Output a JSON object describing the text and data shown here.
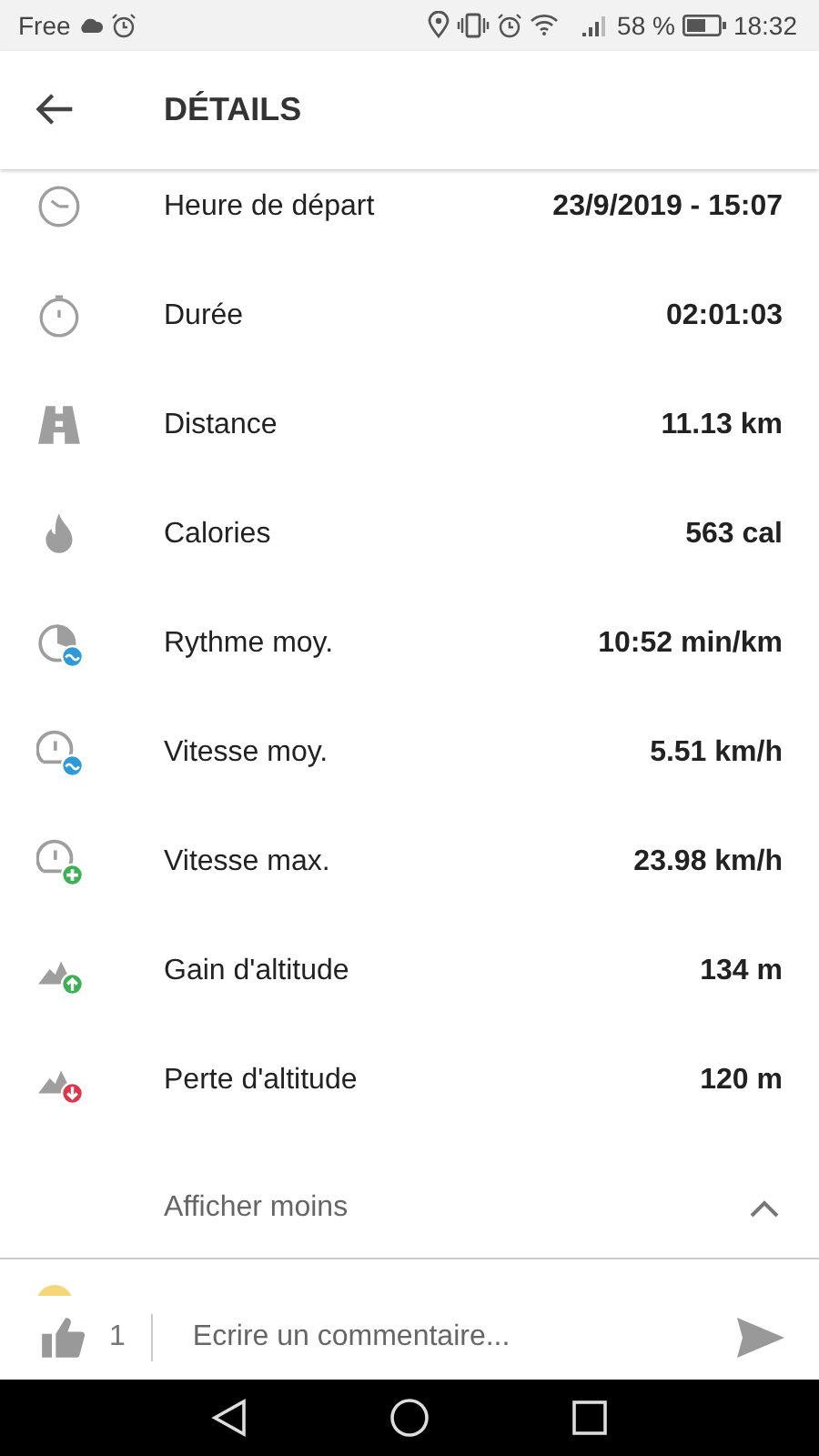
{
  "status_bar": {
    "carrier": "Free",
    "battery": "58 %",
    "time": "18:32"
  },
  "header": {
    "title": "DÉTAILS"
  },
  "rows": [
    {
      "kind": "clock",
      "label": "Heure de départ",
      "value": "23/9/2019 - 15:07"
    },
    {
      "kind": "stopwatch",
      "label": "Durée",
      "value": "02:01:03"
    },
    {
      "kind": "road",
      "label": "Distance",
      "value": "11.13 km"
    },
    {
      "kind": "flame",
      "label": "Calories",
      "value": "563 cal"
    },
    {
      "kind": "pace",
      "label": "Rythme moy.",
      "value": "10:52 min/km"
    },
    {
      "kind": "speed_avg",
      "label": "Vitesse moy.",
      "value": "5.51 km/h"
    },
    {
      "kind": "speed_max",
      "label": "Vitesse max.",
      "value": "23.98 km/h"
    },
    {
      "kind": "gain",
      "label": "Gain d'altitude",
      "value": "134 m"
    },
    {
      "kind": "loss",
      "label": "Perte d'altitude",
      "value": "120 m"
    }
  ],
  "toggle": {
    "label": "Afficher moins",
    "expanded": true
  },
  "comment_bar": {
    "likes": "1",
    "placeholder": "Ecrire un commentaire..."
  }
}
